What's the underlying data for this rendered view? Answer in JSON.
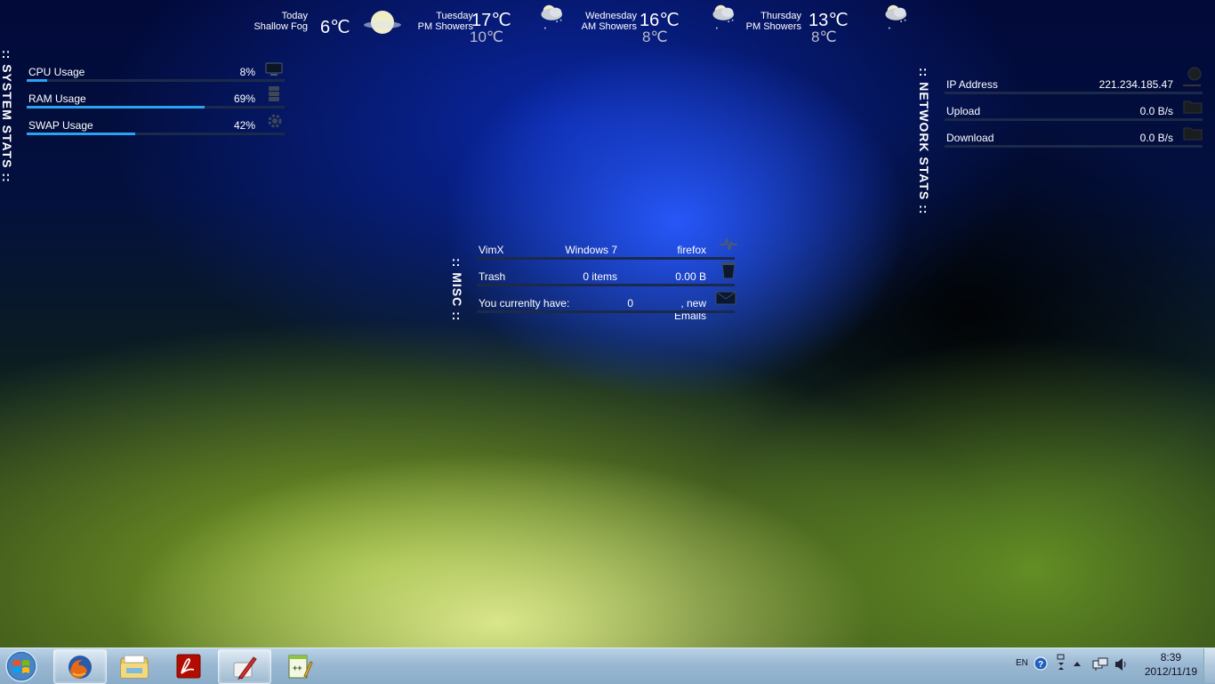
{
  "system_stats": {
    "title": ":: SYSTEM STATS ::",
    "rows": [
      {
        "label": "CPU Usage",
        "value": "8%",
        "fraction": 0.08,
        "icon": "monitor-icon"
      },
      {
        "label": "RAM Usage",
        "value": "69%",
        "fraction": 0.69,
        "icon": "ram-icon"
      },
      {
        "label": "SWAP Usage",
        "value": "42%",
        "fraction": 0.42,
        "icon": "gear-icon"
      }
    ]
  },
  "weather": [
    {
      "day": "Today",
      "cond": "Shallow Fog",
      "temp": "6℃",
      "low": "",
      "icon": "fog-moon-icon"
    },
    {
      "day": "Tuesday",
      "cond": "PM Showers",
      "temp": "17℃",
      "low": "10℃",
      "icon": "showers-icon"
    },
    {
      "day": "Wednesday",
      "cond": "AM Showers",
      "temp": "16℃",
      "low": "8℃",
      "icon": "showers-icon"
    },
    {
      "day": "Thursday",
      "cond": "PM Showers",
      "temp": "13℃",
      "low": "8℃",
      "icon": "showers-icon"
    }
  ],
  "network_stats": {
    "title": ":: NETWORK STATS ::",
    "rows": [
      {
        "label": "IP Address",
        "value": "221.234.185.47",
        "icon": "globe-icon"
      },
      {
        "label": "Upload",
        "value": "0.0 B/s",
        "icon": "folder-icon"
      },
      {
        "label": "Download",
        "value": "0.0 B/s",
        "icon": "folder-icon"
      }
    ]
  },
  "misc": {
    "title": ":: MISC ::",
    "row1": {
      "a": "VimX",
      "b": "Windows 7",
      "c": "firefox"
    },
    "row2": {
      "a": "Trash",
      "b": "0 items",
      "c": "0.00 B"
    },
    "row3": {
      "a": "You currenlty have:",
      "b": "0",
      "c": ", new Emails"
    }
  },
  "taskbar": {
    "apps": [
      "firefox-icon",
      "explorer-icon",
      "acrobat-icon",
      "paint-icon",
      "notepad-plus-icon"
    ],
    "lang": "EN",
    "time": "8:39",
    "date": "2012/11/19"
  },
  "colors": {
    "accent": "#2aa3f0",
    "track": "#1b2a4a"
  }
}
